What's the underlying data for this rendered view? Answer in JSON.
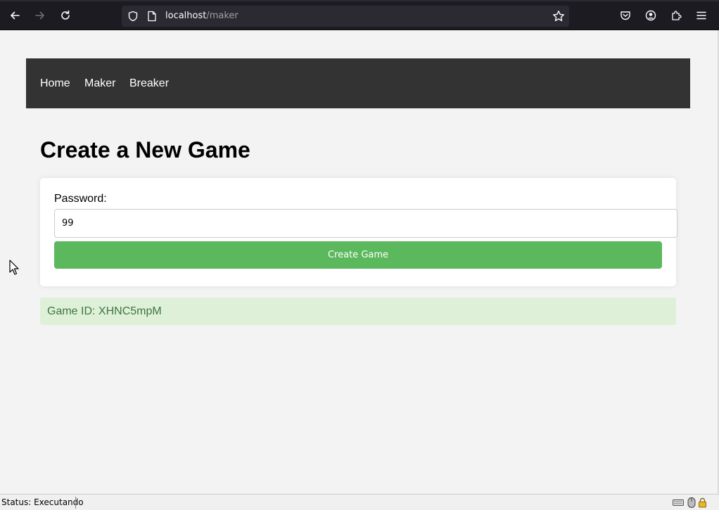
{
  "browser": {
    "url_host": "localhost",
    "url_path": "/maker"
  },
  "nav": {
    "items": [
      "Home",
      "Maker",
      "Breaker"
    ]
  },
  "page": {
    "title": "Create a New Game",
    "password_label": "Password:",
    "password_value": "99",
    "create_button": "Create Game",
    "result_text": "Game ID: XHNC5mpM"
  },
  "status": {
    "text": "Status: Executando"
  },
  "colors": {
    "navbar": "#333333",
    "button": "#5cb85c",
    "result_bg": "#dff0d8",
    "result_text": "#3c763d"
  }
}
